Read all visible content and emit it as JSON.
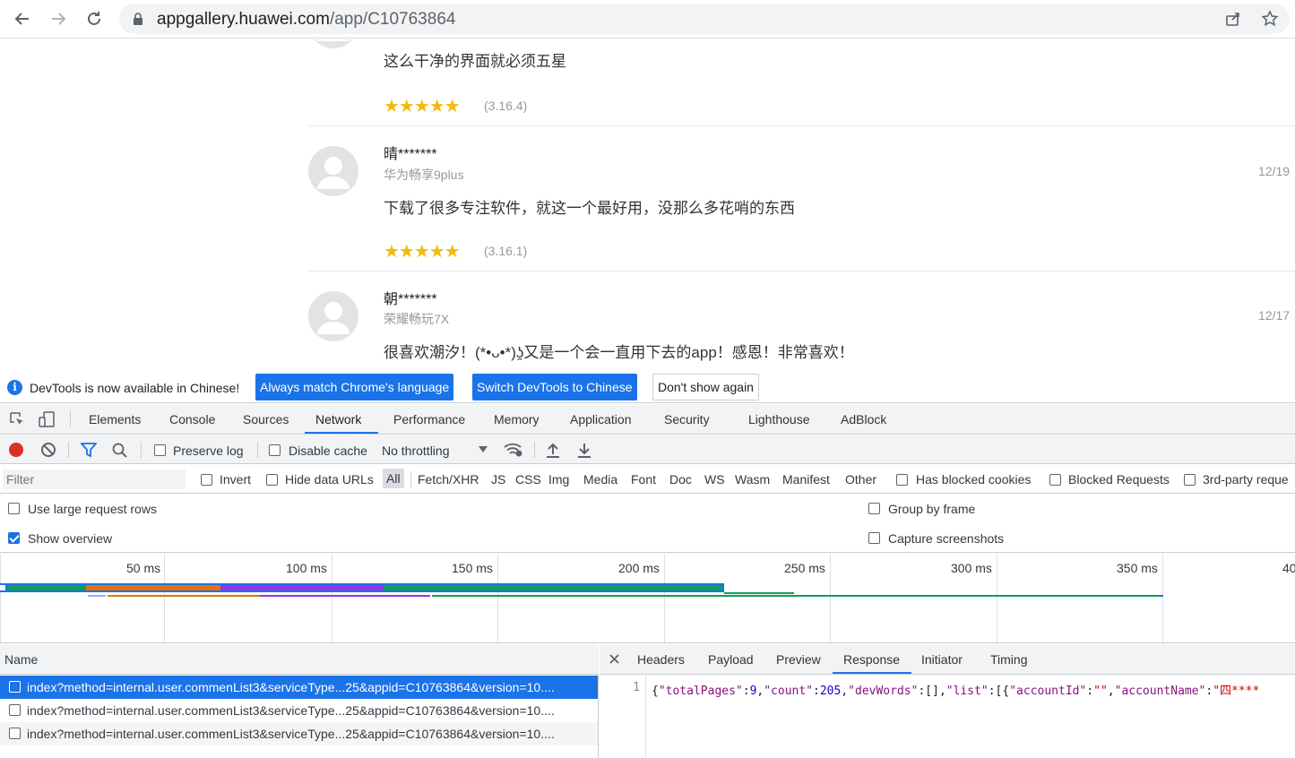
{
  "browser": {
    "url_host": "appgallery.huawei.com",
    "url_path": "/app/C10763864"
  },
  "reviews": [
    {
      "name": "",
      "device": "",
      "date": "",
      "text": "这么干净的界面就必须五星",
      "stars": "★★★★★",
      "version": "(3.16.4)"
    },
    {
      "name": "晴*******",
      "device": "华为畅享9plus",
      "date": "12/19",
      "text": "下载了很多专注软件，就这一个最好用，没那么多花哨的东西",
      "stars": "★★★★★",
      "version": "(3.16.1)"
    },
    {
      "name": "朝*******",
      "device": "荣耀畅玩7X",
      "date": "12/17",
      "text": "很喜欢潮汐！(*•ᴗ•*)ʖ̯又是一个会一直用下去的app！感恩！非常喜欢！",
      "stars": "",
      "version": ""
    }
  ],
  "devtools": {
    "lang_bar": {
      "message": "DevTools is now available in Chinese!",
      "btn_match": "Always match Chrome's language",
      "btn_switch": "Switch DevTools to Chinese",
      "btn_dismiss": "Don't show again"
    },
    "tabs": [
      "Elements",
      "Console",
      "Sources",
      "Network",
      "Performance",
      "Memory",
      "Application",
      "Security",
      "Lighthouse",
      "AdBlock"
    ],
    "active_tab": "Network",
    "toolbar": {
      "preserve_log": "Preserve log",
      "disable_cache": "Disable cache",
      "throttling": "No throttling"
    },
    "filter": {
      "placeholder": "Filter",
      "invert": "Invert",
      "hide_data_urls": "Hide data URLs",
      "types": [
        "All",
        "Fetch/XHR",
        "JS",
        "CSS",
        "Img",
        "Media",
        "Font",
        "Doc",
        "WS",
        "Wasm",
        "Manifest",
        "Other"
      ],
      "has_blocked_cookies": "Has blocked cookies",
      "blocked_requests": "Blocked Requests",
      "third_party": "3rd-party reque"
    },
    "settings": {
      "large_rows": "Use large request rows",
      "show_overview": "Show overview",
      "group_by_frame": "Group by frame",
      "capture_screenshots": "Capture screenshots"
    },
    "overview_ticks": [
      "50 ms",
      "100 ms",
      "150 ms",
      "200 ms",
      "250 ms",
      "300 ms",
      "350 ms",
      "40"
    ],
    "colors": {
      "accent": "#1a73e8",
      "record": "#d93025",
      "bar_teal": "#0f9d58",
      "bar_orange": "#e8710a",
      "bar_purple": "#9334e6",
      "bar_blue": "#1a73e8"
    },
    "request_list": {
      "header": "Name",
      "rows": [
        "index?method=internal.user.commenList3&serviceType...25&appid=C10763864&version=10....",
        "index?method=internal.user.commenList3&serviceType...25&appid=C10763864&version=10....",
        "index?method=internal.user.commenList3&serviceType...25&appid=C10763864&version=10...."
      ]
    },
    "detail": {
      "tabs": [
        "Headers",
        "Payload",
        "Preview",
        "Response",
        "Initiator",
        "Timing"
      ],
      "active_tab": "Response",
      "line_number": "1",
      "json": {
        "k1": "\"totalPages\"",
        "v1": "9",
        "k2": "\"count\"",
        "v2": "205",
        "k3": "\"devWords\"",
        "v3": "[]",
        "k4": "\"list\"",
        "k5": "\"accountId\"",
        "v5": "\"\"",
        "k6": "\"accountName\"",
        "v6": "\"四****"
      }
    }
  }
}
